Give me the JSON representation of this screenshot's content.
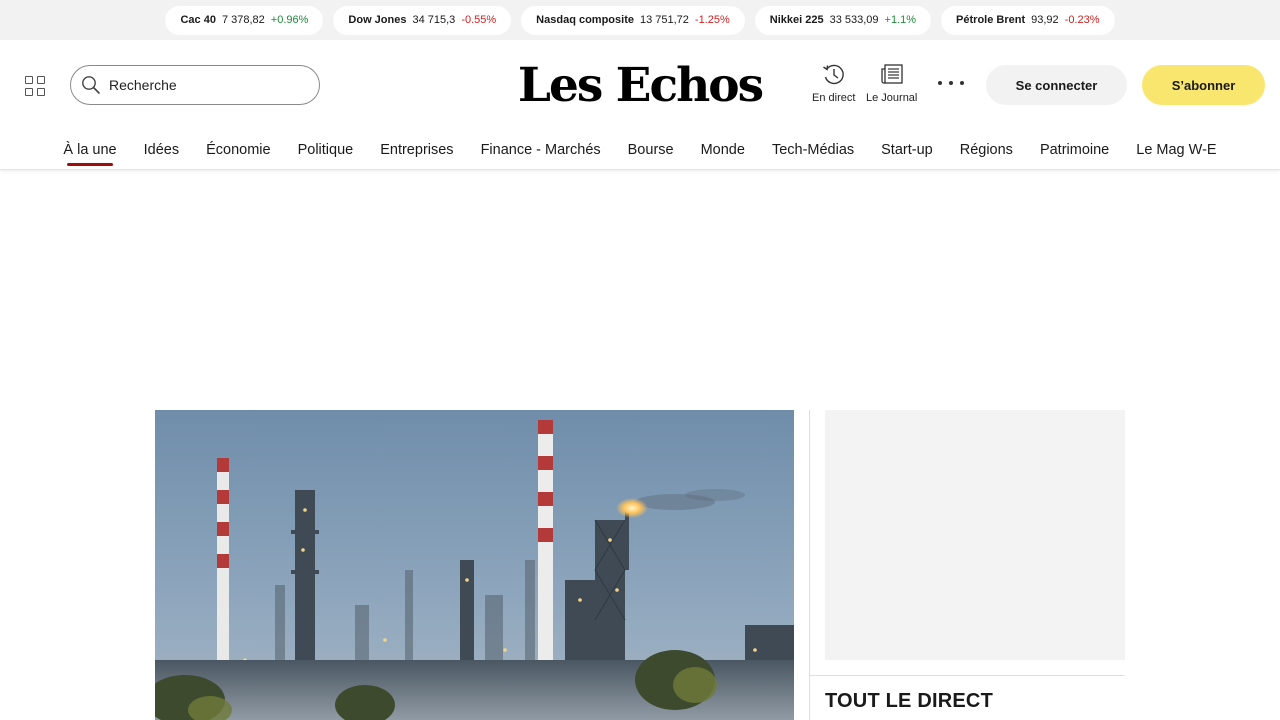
{
  "ticker": [
    {
      "name": "Cac 40",
      "value": "7 378,82",
      "change": "+0.96%",
      "trend": "up"
    },
    {
      "name": "Dow Jones",
      "value": "34 715,3",
      "change": "-0.55%",
      "trend": "down"
    },
    {
      "name": "Nasdaq composite",
      "value": "13 751,72",
      "change": "-1.25%",
      "trend": "down"
    },
    {
      "name": "Nikkei 225",
      "value": "33 533,09",
      "change": "+1.1%",
      "trend": "up"
    },
    {
      "name": "Pétrole Brent",
      "value": "93,92",
      "change": "-0.23%",
      "trend": "down"
    }
  ],
  "header": {
    "search_placeholder": "Recherche",
    "logo": "Les Echos",
    "live_label": "En direct",
    "journal_label": "Le Journal",
    "login_label": "Se connecter",
    "subscribe_label": "S’abonner"
  },
  "nav": {
    "items": [
      "À la une",
      "Idées",
      "Économie",
      "Politique",
      "Entreprises",
      "Finance - Marchés",
      "Bourse",
      "Monde",
      "Tech-Médias",
      "Start-up",
      "Régions",
      "Patrimoine",
      "Le Mag W-E"
    ],
    "active_index": 0
  },
  "sidebar": {
    "direct_title": "TOUT LE DIRECT"
  },
  "colors": {
    "up": "#1f8a3a",
    "down": "#d01f1f",
    "subscribe": "#f9e66f",
    "nav_active": "#a10d0d"
  }
}
